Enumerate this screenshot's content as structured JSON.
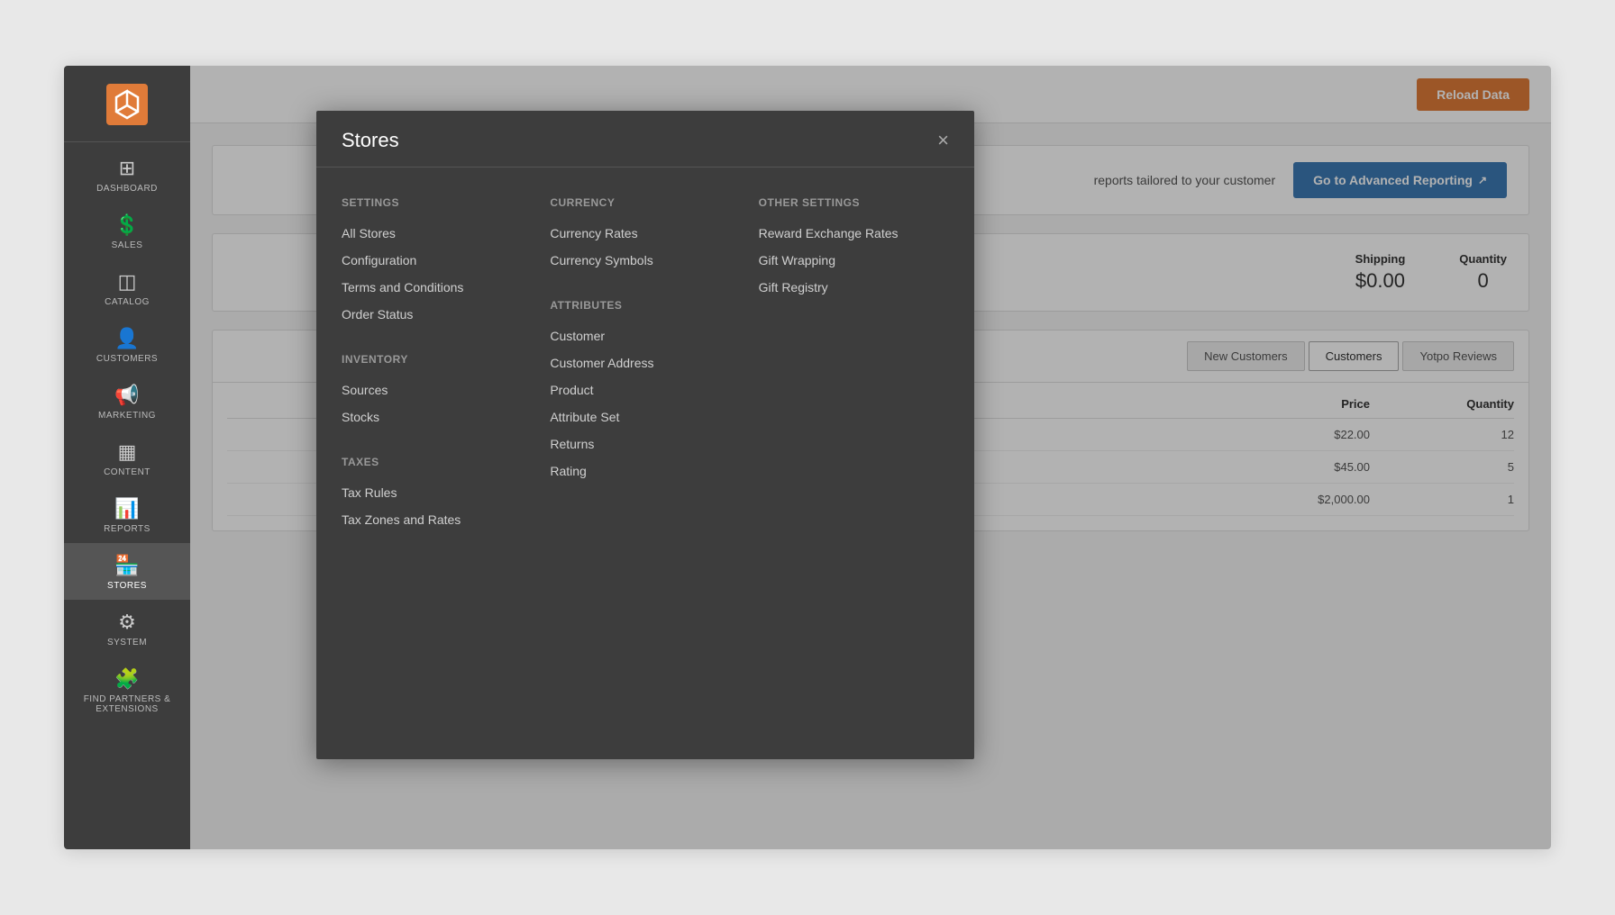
{
  "sidebar": {
    "items": [
      {
        "id": "dashboard",
        "label": "DASHBOARD",
        "icon": "⊞",
        "active": false
      },
      {
        "id": "sales",
        "label": "SALES",
        "icon": "$",
        "active": false
      },
      {
        "id": "catalog",
        "label": "CATALOG",
        "icon": "◫",
        "active": false
      },
      {
        "id": "customers",
        "label": "CUSTOMERS",
        "icon": "👤",
        "active": false
      },
      {
        "id": "marketing",
        "label": "MARKETING",
        "icon": "📢",
        "active": false
      },
      {
        "id": "content",
        "label": "CONTENT",
        "icon": "▦",
        "active": false
      },
      {
        "id": "reports",
        "label": "REPORTS",
        "icon": "📊",
        "active": false
      },
      {
        "id": "stores",
        "label": "STORES",
        "icon": "🏪",
        "active": true
      },
      {
        "id": "system",
        "label": "SYSTEM",
        "icon": "⚙",
        "active": false
      },
      {
        "id": "extensions",
        "label": "FIND PARTNERS & EXTENSIONS",
        "icon": "🧩",
        "active": false
      }
    ]
  },
  "header": {
    "reload_label": "Reload Data"
  },
  "reporting": {
    "text": "reports tailored to your customer",
    "button_label": "Go to Advanced Reporting"
  },
  "stats": [
    {
      "label": "Shipping",
      "value": "$0.00"
    },
    {
      "label": "Quantity",
      "value": "0"
    }
  ],
  "tabs": [
    {
      "label": "New Customers",
      "active": false
    },
    {
      "label": "Customers",
      "active": true
    },
    {
      "label": "Yotpo Reviews",
      "active": false
    }
  ],
  "table": {
    "headers": [
      "Price",
      "Quantity"
    ],
    "rows": [
      {
        "price": "$22.00",
        "quantity": "12"
      },
      {
        "price": "$45.00",
        "quantity": "5"
      },
      {
        "price": "$2,000.00",
        "quantity": "1"
      }
    ]
  },
  "modal": {
    "title": "Stores",
    "close_label": "×",
    "columns": [
      {
        "sections": [
          {
            "title": "Settings",
            "items": [
              "All Stores",
              "Configuration",
              "Terms and Conditions",
              "Order Status"
            ]
          },
          {
            "title": "Inventory",
            "items": [
              "Sources",
              "Stocks"
            ]
          },
          {
            "title": "Taxes",
            "items": [
              "Tax Rules",
              "Tax Zones and Rates"
            ]
          }
        ]
      },
      {
        "sections": [
          {
            "title": "Currency",
            "items": [
              "Currency Rates",
              "Currency Symbols"
            ]
          },
          {
            "title": "Attributes",
            "items": [
              "Customer",
              "Customer Address",
              "Product",
              "Attribute Set",
              "Returns",
              "Rating"
            ]
          }
        ]
      },
      {
        "sections": [
          {
            "title": "Other Settings",
            "items": [
              "Reward Exchange Rates",
              "Gift Wrapping",
              "Gift Registry"
            ]
          }
        ]
      }
    ]
  }
}
